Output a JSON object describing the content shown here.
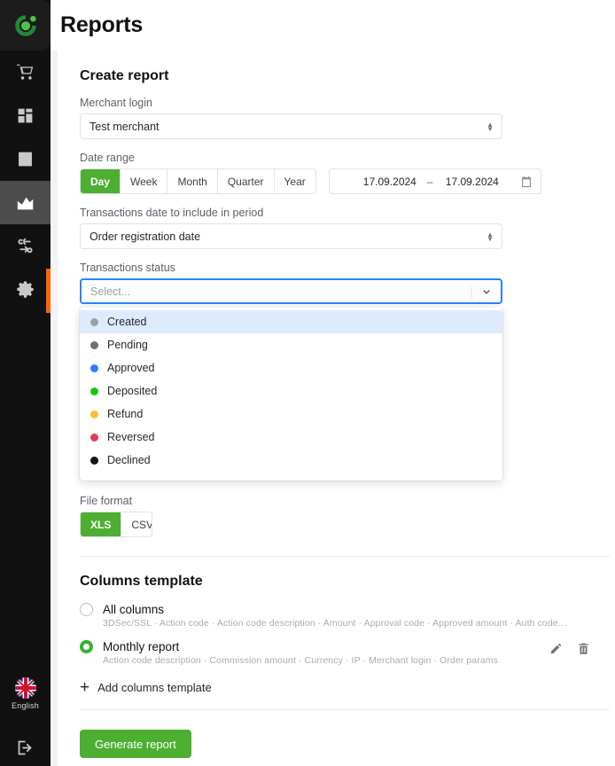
{
  "header": {
    "title": "Reports"
  },
  "sidebar": {
    "logo_name": "app-logo",
    "items": [
      {
        "icon": "cart-icon",
        "name": "sidebar-item-orders",
        "active": false
      },
      {
        "icon": "dashboard-icon",
        "name": "sidebar-item-dashboard",
        "active": false
      },
      {
        "icon": "list-icon",
        "name": "sidebar-item-documents",
        "active": false
      },
      {
        "icon": "chart-icon",
        "name": "sidebar-item-reports",
        "active": true
      },
      {
        "icon": "transfer-icon",
        "name": "sidebar-item-transfers",
        "active": false
      },
      {
        "icon": "gear-icon",
        "name": "sidebar-item-settings",
        "active": false
      }
    ],
    "language": {
      "label": "English",
      "icon": "uk-flag-icon"
    },
    "logout": {
      "icon": "logout-icon"
    },
    "accent_color": "#fa6400"
  },
  "form": {
    "title": "Create report",
    "merchant": {
      "label": "Merchant login",
      "value": "Test merchant"
    },
    "date_range": {
      "label": "Date range",
      "presets": [
        "Day",
        "Week",
        "Month",
        "Quarter",
        "Year"
      ],
      "selected_preset": "Day",
      "from": "17.09.2024",
      "dash": "–",
      "to": "17.09.2024",
      "calendar_icon": "calendar-icon"
    },
    "transactions_date": {
      "label": "Transactions date to include in period",
      "value": "Order registration date"
    },
    "transactions_status": {
      "label": "Transactions status",
      "placeholder": "Select...",
      "options": [
        {
          "label": "Created",
          "color": "#9aa0a6",
          "highlighted": true
        },
        {
          "label": "Pending",
          "color": "#6b7075",
          "highlighted": false
        },
        {
          "label": "Approved",
          "color": "#2f7df6",
          "highlighted": false
        },
        {
          "label": "Deposited",
          "color": "#16c60c",
          "highlighted": false
        },
        {
          "label": "Refund",
          "color": "#fbc02d",
          "highlighted": false
        },
        {
          "label": "Reversed",
          "color": "#e03c5a",
          "highlighted": false
        },
        {
          "label": "Declined",
          "color": "#151515",
          "highlighted": false
        }
      ]
    },
    "file_format": {
      "label": "File format",
      "options": [
        "XLS",
        "CSV"
      ],
      "selected": "XLS"
    }
  },
  "columns_template": {
    "title": "Columns template",
    "items": [
      {
        "name": "All columns",
        "selected": false,
        "columns": "3DSec/SSL · Action code · Action code description · Amount · Approval code · Approved amount · Auth code…",
        "has_actions": false
      },
      {
        "name": "Monthly report",
        "selected": true,
        "columns": "Action code description · Commission amount · Currency · IP · Merchant login · Order params",
        "has_actions": true,
        "edit_icon": "pencil-icon",
        "delete_icon": "trash-icon"
      }
    ],
    "add_label": "Add columns template",
    "add_icon": "plus-icon"
  },
  "footer": {
    "generate_label": "Generate report",
    "accent_green": "#4caf32"
  }
}
